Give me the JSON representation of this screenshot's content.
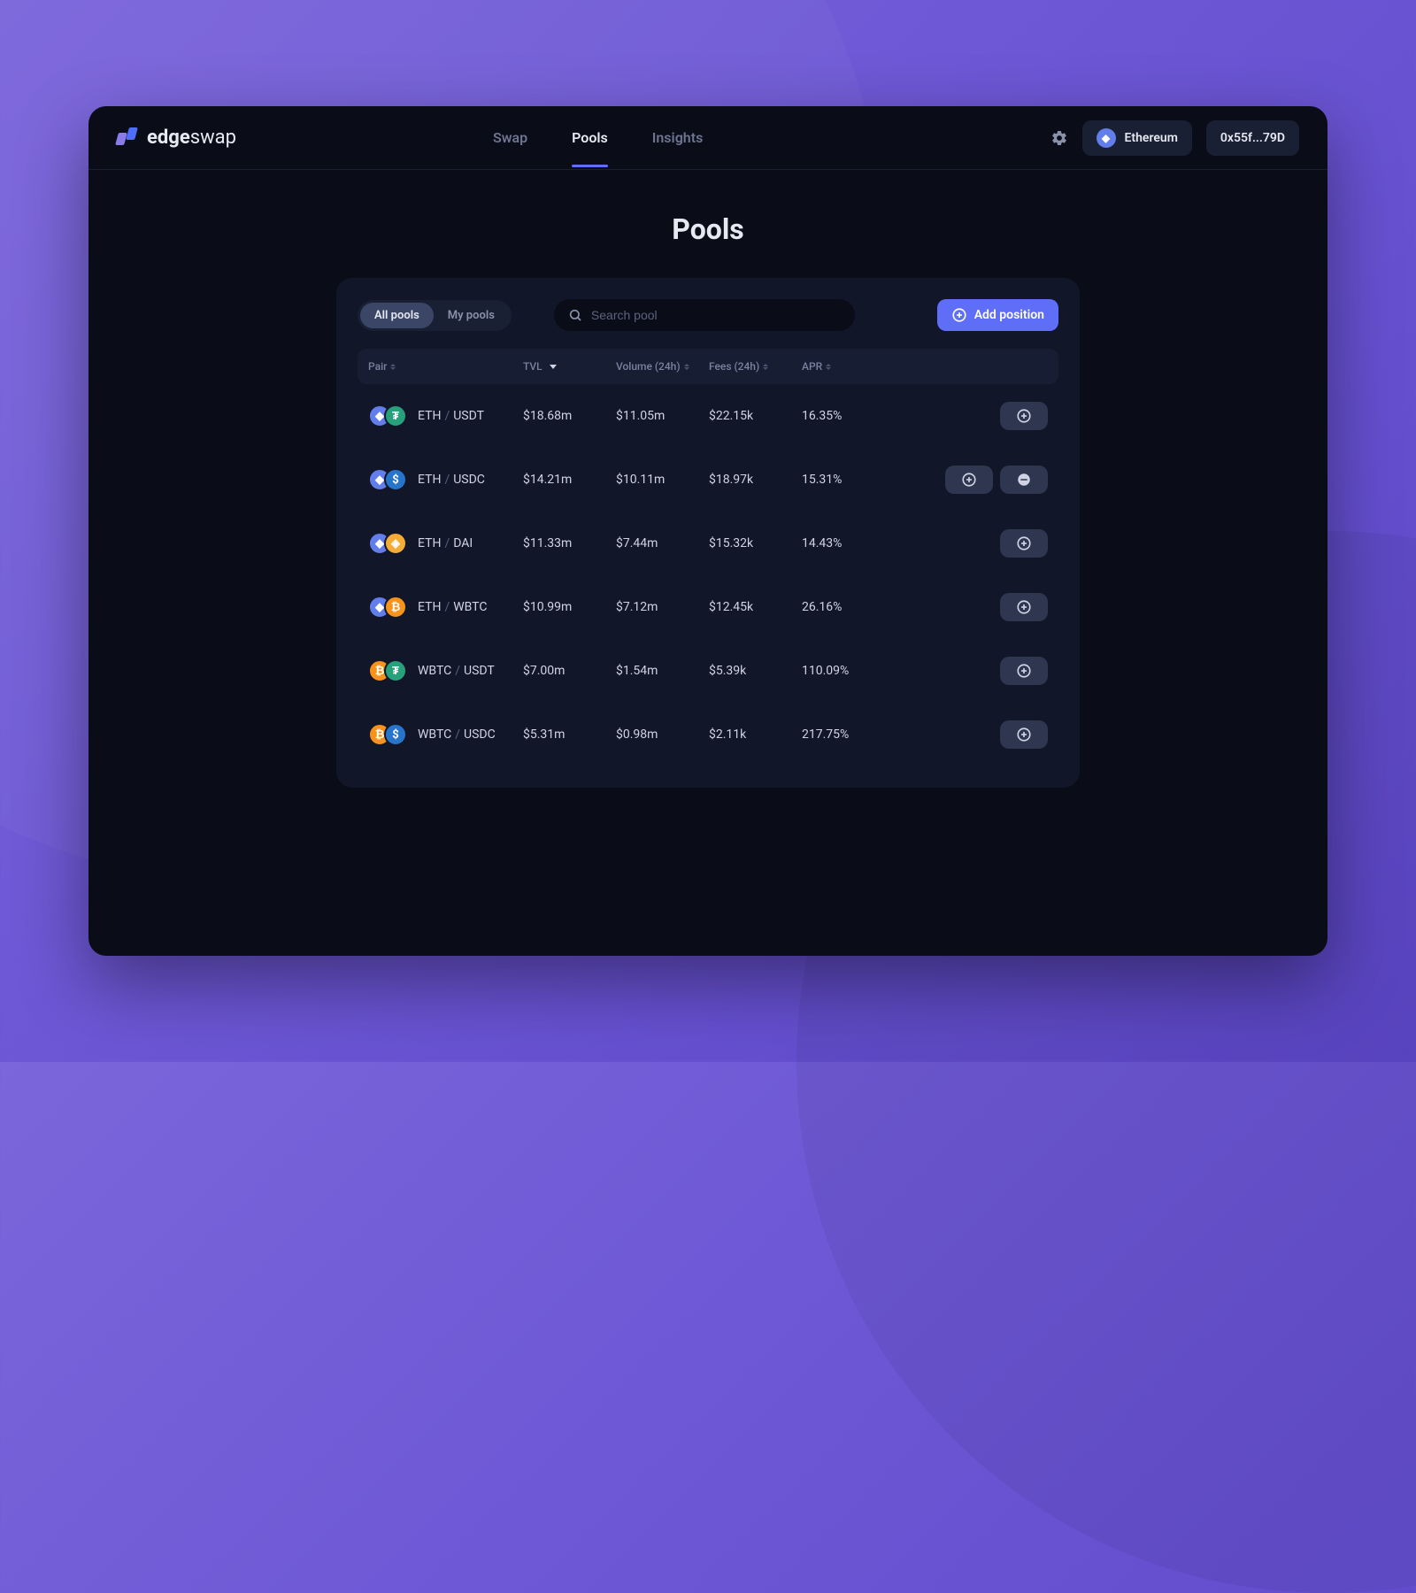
{
  "brand": {
    "bold": "edge",
    "light": "swap"
  },
  "nav": {
    "items": [
      {
        "label": "Swap",
        "active": false
      },
      {
        "label": "Pools",
        "active": true
      },
      {
        "label": "Insights",
        "active": false
      }
    ]
  },
  "topbar": {
    "network_label": "Ethereum",
    "wallet_short": "0x55f...79D"
  },
  "page": {
    "title": "Pools"
  },
  "filters": {
    "tabs": [
      {
        "label": "All pools",
        "active": true
      },
      {
        "label": "My pools",
        "active": false
      }
    ],
    "search_placeholder": "Search pool",
    "add_button": "Add position"
  },
  "columns": {
    "pair": "Pair",
    "tvl": "TVL",
    "volume": "Volume (24h)",
    "fees": "Fees (24h)",
    "apr": "APR"
  },
  "rows": [
    {
      "a": "ETH",
      "b": "USDT",
      "tvl": "$18.68m",
      "vol": "$11.05m",
      "fees": "$22.15k",
      "apr": "16.35%",
      "ca": "#627eea",
      "cb": "#26a17b",
      "ib": "₮",
      "has_minus": false
    },
    {
      "a": "ETH",
      "b": "USDC",
      "tvl": "$14.21m",
      "vol": "$10.11m",
      "fees": "$18.97k",
      "apr": "15.31%",
      "ca": "#627eea",
      "cb": "#2775ca",
      "ib": "$",
      "has_minus": true
    },
    {
      "a": "ETH",
      "b": "DAI",
      "tvl": "$11.33m",
      "vol": "$7.44m",
      "fees": "$15.32k",
      "apr": "14.43%",
      "ca": "#627eea",
      "cb": "#f5ac37",
      "ib": "◈",
      "has_minus": false
    },
    {
      "a": "ETH",
      "b": "WBTC",
      "tvl": "$10.99m",
      "vol": "$7.12m",
      "fees": "$12.45k",
      "apr": "26.16%",
      "ca": "#627eea",
      "cb": "#f7931a",
      "ib": "₿",
      "has_minus": false
    },
    {
      "a": "WBTC",
      "b": "USDT",
      "tvl": "$7.00m",
      "vol": "$1.54m",
      "fees": "$5.39k",
      "apr": "110.09%",
      "ca": "#f7931a",
      "cb": "#26a17b",
      "ib": "₮",
      "has_minus": false
    },
    {
      "a": "WBTC",
      "b": "USDC",
      "tvl": "$5.31m",
      "vol": "$0.98m",
      "fees": "$2.11k",
      "apr": "217.75%",
      "ca": "#f7931a",
      "cb": "#2775ca",
      "ib": "$",
      "has_minus": false
    }
  ]
}
